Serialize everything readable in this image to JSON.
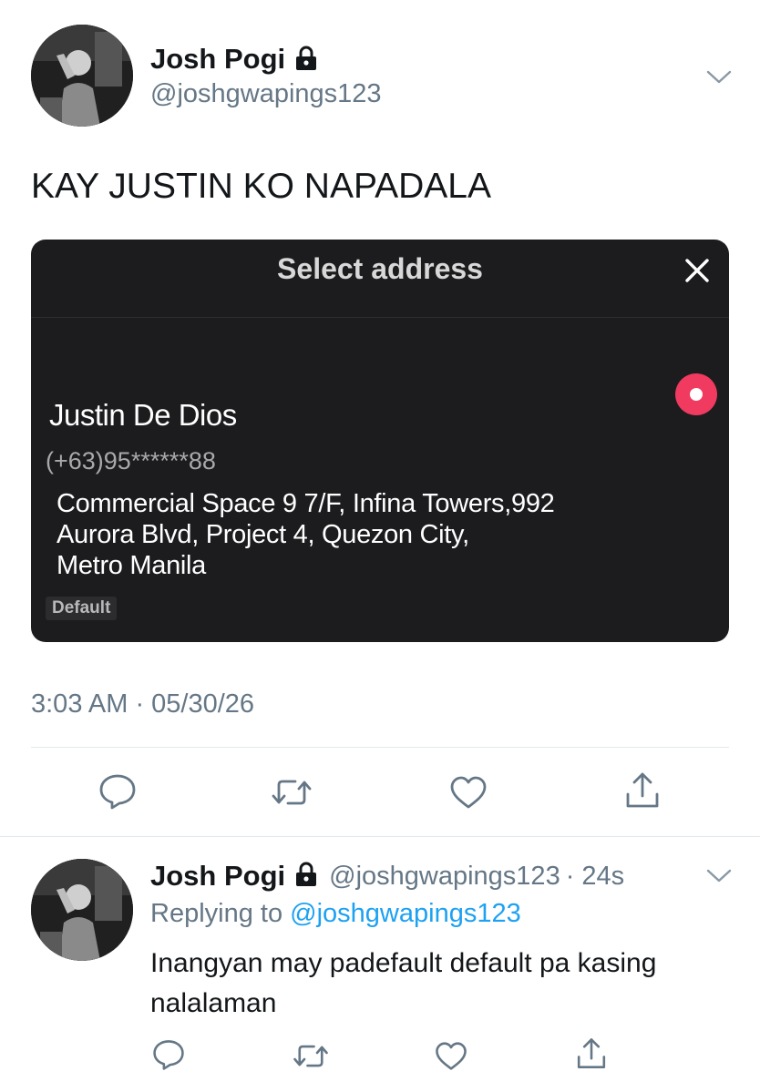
{
  "tweet": {
    "author_name": "Josh Pogi",
    "author_handle": "@joshgwapings123",
    "text": "KAY JUSTIN KO NAPADALA",
    "timestamp": "3:03 AM · 05/30/26"
  },
  "card": {
    "title": "Select address",
    "recipient_name": "Justin De Dios",
    "phone": "(+63)95******88",
    "address_lines": [
      "Commercial Space 9 7/F, Infina Towers,992",
      "Aurora Blvd, Project 4, Quezon City,",
      "Metro Manila"
    ],
    "badge": "Default",
    "accent_color": "#f03a5f"
  },
  "reply": {
    "author_name": "Josh Pogi",
    "author_handle": "@joshgwapings123",
    "age": "· 24s",
    "replying_prefix": "Replying to",
    "replying_handle": "@joshgwapings123",
    "text_line1": "Inangyan may padefault default pa kasing",
    "text_line2": "nalalaman"
  },
  "icons": {
    "lock": "lock-icon",
    "chevron": "chevron-down-icon",
    "close": "close-icon",
    "reply": "comment-icon",
    "retweet": "retweet-icon",
    "like": "heart-icon",
    "share": "share-icon"
  }
}
